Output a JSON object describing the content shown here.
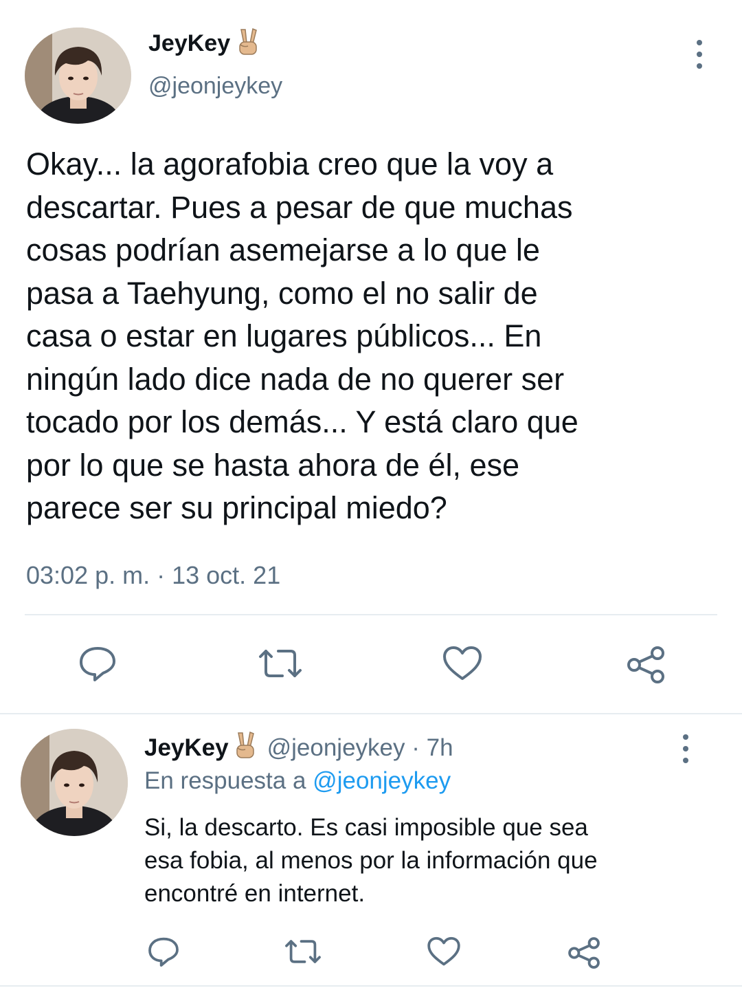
{
  "main_tweet": {
    "display_name": "JeyKey",
    "emoji": "victory-hand-emoji",
    "handle": "@jeonjeykey",
    "text": "Okay... la agorafobia creo que la voy a descartar. Pues a pesar de que muchas cosas podrían asemejarse a lo que le pasa a Taehyung, como el no salir de casa o estar en lugares públicos... En ningún lado dice nada de no querer ser tocado por los demás... Y está claro que por lo que se hasta ahora de él, ese parece ser su principal miedo?",
    "lines": [
      "Okay... la agorafobia creo que la voy a",
      "descartar. Pues a pesar de que muchas",
      "cosas podrían asemejarse a lo que le",
      "pasa a Taehyung, como el no salir de",
      "casa o estar en lugares públicos... En",
      "ningún lado dice nada de no querer ser",
      "tocado por los demás... Y está claro que",
      "por lo que se hasta ahora de él, ese",
      "parece ser su principal miedo?"
    ],
    "timestamp": "03:02 p. m. · 13 oct. 21",
    "actions": [
      "reply-icon",
      "retweet-icon",
      "like-icon",
      "share-icon"
    ]
  },
  "reply_tweet": {
    "display_name": "JeyKey",
    "emoji": "victory-hand-emoji",
    "handle_time": "@jeonjeykey · 7h",
    "replying_to_prefix": "En respuesta a",
    "replying_to_handle": "@jeonjeykey",
    "lines": [
      "Si, la descarto. Es casi imposible que sea",
      "esa fobia, al menos por la información que",
      "encontré en internet."
    ],
    "actions": [
      "reply-icon",
      "retweet-icon",
      "like-icon",
      "share-icon"
    ]
  },
  "colors": {
    "text": "#0f1419",
    "secondary": "#5b7083",
    "link": "#1d9bf0",
    "divider": "#e6ecf0"
  }
}
